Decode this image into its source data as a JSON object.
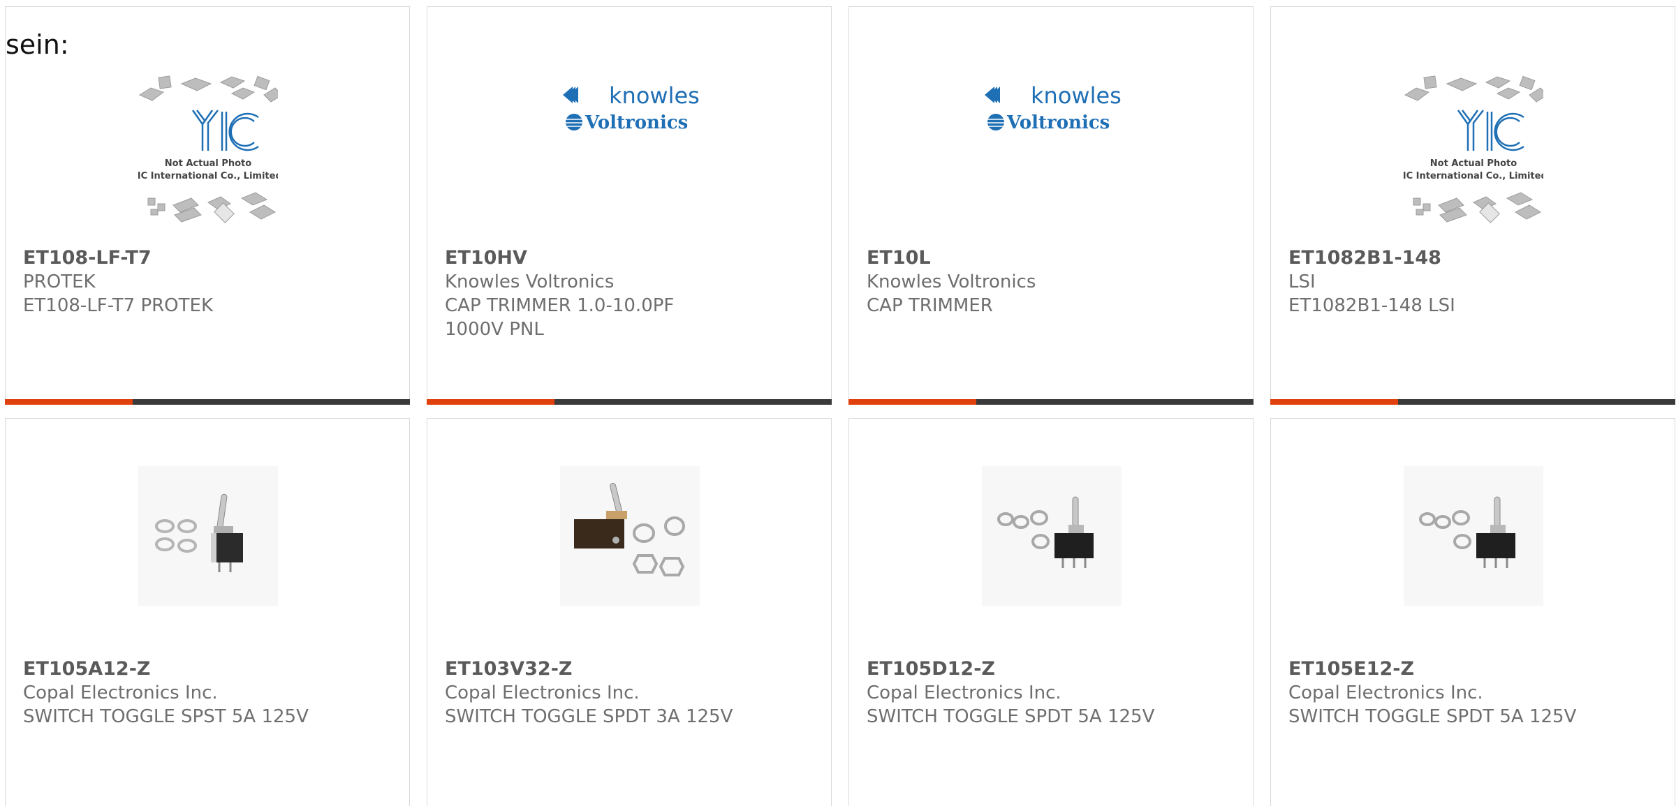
{
  "intro_text": "sein:",
  "products": [
    {
      "part_number": "ET108-LF-T7",
      "manufacturer": "PROTEK",
      "description": "ET108-LF-T7 PROTEK",
      "image": "yic-placeholder",
      "image_caption_line1": "Not Actual Photo",
      "image_caption_line2": "YIC International Co., Limited."
    },
    {
      "part_number": "ET10HV",
      "manufacturer": "Knowles Voltronics",
      "description": "CAP TRIMMER 1.0-10.0PF 1000V PNL",
      "image": "knowles-voltronics-logo",
      "logo_line1": "knowles",
      "logo_line2": "Voltronics"
    },
    {
      "part_number": "ET10L",
      "manufacturer": "Knowles Voltronics",
      "description": "CAP TRIMMER",
      "image": "knowles-voltronics-logo",
      "logo_line1": "knowles",
      "logo_line2": "Voltronics"
    },
    {
      "part_number": "ET1082B1-148",
      "manufacturer": "LSI",
      "description": "ET1082B1-148 LSI",
      "image": "yic-placeholder",
      "image_caption_line1": "Not Actual Photo",
      "image_caption_line2": "YIC International Co., Limited."
    },
    {
      "part_number": "ET105A12-Z",
      "manufacturer": "Copal Electronics Inc.",
      "description": "SWITCH TOGGLE SPST 5A 125V",
      "image": "toggle-switch-photo"
    },
    {
      "part_number": "ET103V32-Z",
      "manufacturer": "Copal Electronics Inc.",
      "description": "SWITCH TOGGLE SPDT 3A 125V",
      "image": "toggle-switch-photo"
    },
    {
      "part_number": "ET105D12-Z",
      "manufacturer": "Copal Electronics Inc.",
      "description": "SWITCH TOGGLE SPDT 5A 125V",
      "image": "toggle-switch-photo"
    },
    {
      "part_number": "ET105E12-Z",
      "manufacturer": "Copal Electronics Inc.",
      "description": "SWITCH TOGGLE SPDT 5A 125V",
      "image": "toggle-switch-photo"
    }
  ],
  "colors": {
    "accent": "#e0400c",
    "bar": "#3a3a3a",
    "logo_blue": "#1f6fb5",
    "text": "#6e6e6e"
  }
}
